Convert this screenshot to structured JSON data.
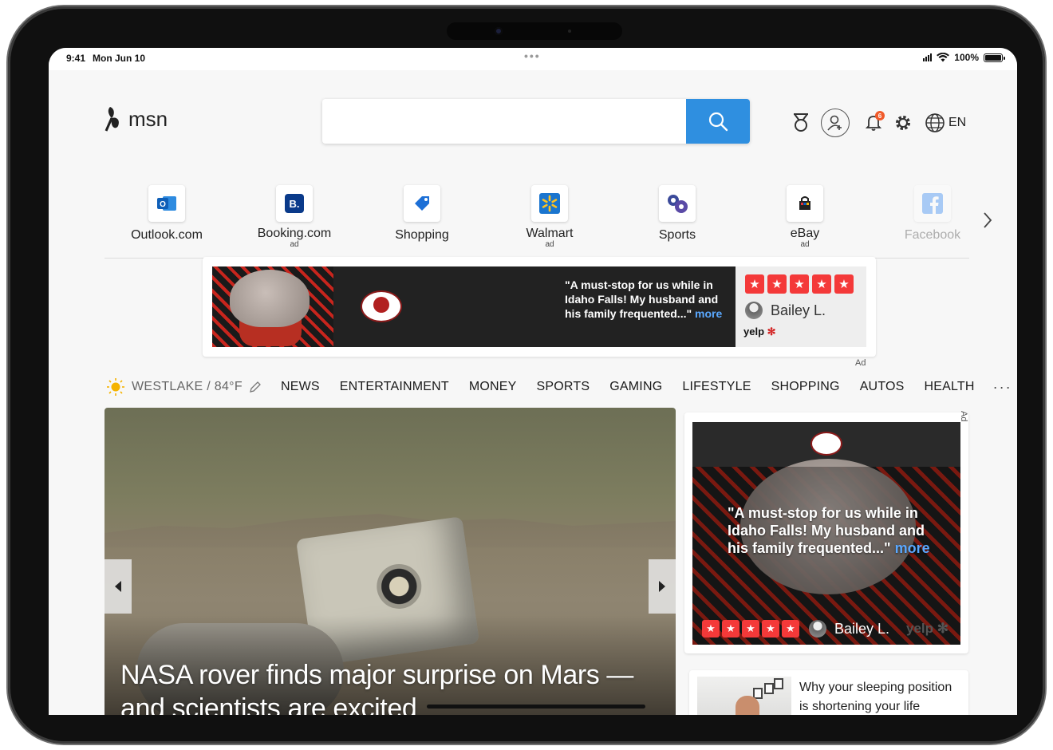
{
  "status_bar": {
    "time": "9:41",
    "date": "Mon Jun 10",
    "battery": "100%",
    "battery_level": 1.0
  },
  "header": {
    "logo_text": "msn",
    "search": {
      "placeholder": "",
      "value": ""
    },
    "language": "EN",
    "notification_count": "6"
  },
  "quick_links": [
    {
      "label": "Outlook.com",
      "ad": "",
      "icon": "outlook-icon"
    },
    {
      "label": "Booking.com",
      "ad": "ad",
      "icon": "booking-icon"
    },
    {
      "label": "Shopping",
      "ad": "",
      "icon": "shopping-tag-icon"
    },
    {
      "label": "Walmart",
      "ad": "ad",
      "icon": "walmart-icon"
    },
    {
      "label": "Sports",
      "ad": "",
      "icon": "sports-icon"
    },
    {
      "label": "eBay",
      "ad": "ad",
      "icon": "ebay-icon"
    },
    {
      "label": "Facebook",
      "ad": "",
      "icon": "facebook-icon"
    }
  ],
  "banner_ad": {
    "quote": "\"A must-stop for us while in Idaho Falls! My husband and his family frequented...\"",
    "more": "more",
    "stars": 5,
    "reviewer": "Bailey L.",
    "brand": "yelp",
    "ad_label": "Ad"
  },
  "nav": {
    "weather": "WESTLAKE / 84°F",
    "items": [
      "NEWS",
      "ENTERTAINMENT",
      "MONEY",
      "SPORTS",
      "GAMING",
      "LIFESTYLE",
      "SHOPPING",
      "AUTOS",
      "HEALTH"
    ],
    "more": "···"
  },
  "hero": {
    "title": "NASA rover finds major surprise on Mars — and scientists are excited"
  },
  "side_ad": {
    "quote": "\"A must-stop for us while in Idaho Falls! My husband and his family frequented...\"",
    "more": "more",
    "stars": 5,
    "reviewer": "Bailey L.",
    "brand": "yelp",
    "ad_label": "Ad"
  },
  "story": {
    "title": "Why your sleeping position is shortening your life"
  },
  "colors": {
    "accent": "#2f8fe0",
    "star_red": "#f43939",
    "badge": "#f05a2a"
  }
}
